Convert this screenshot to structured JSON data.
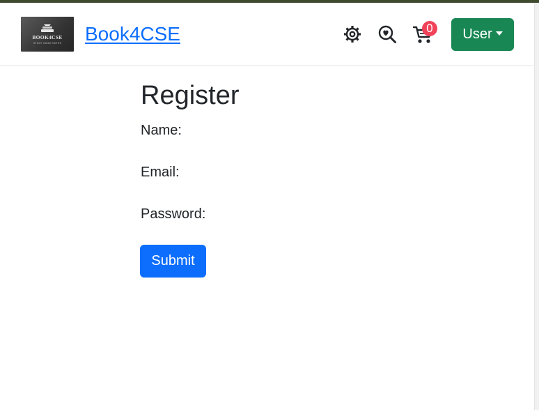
{
  "header": {
    "logo_text": "BOOK4CSE",
    "logo_subtext": "STUDY GUIDE NOTES",
    "brand": "Book4CSE",
    "cart_count": "0",
    "user_label": "User",
    "icons": [
      "gear-icon",
      "search-heart-icon",
      "cart-icon",
      "chevron-down-icon"
    ]
  },
  "form": {
    "title": "Register",
    "name_label": "Name:",
    "email_label": "Email:",
    "password_label": "Password:",
    "submit_label": "Submit"
  },
  "colors": {
    "brand_link": "#0d6efd",
    "user_button": "#198754",
    "submit_button": "#0d6efd",
    "badge": "#f0435a"
  }
}
